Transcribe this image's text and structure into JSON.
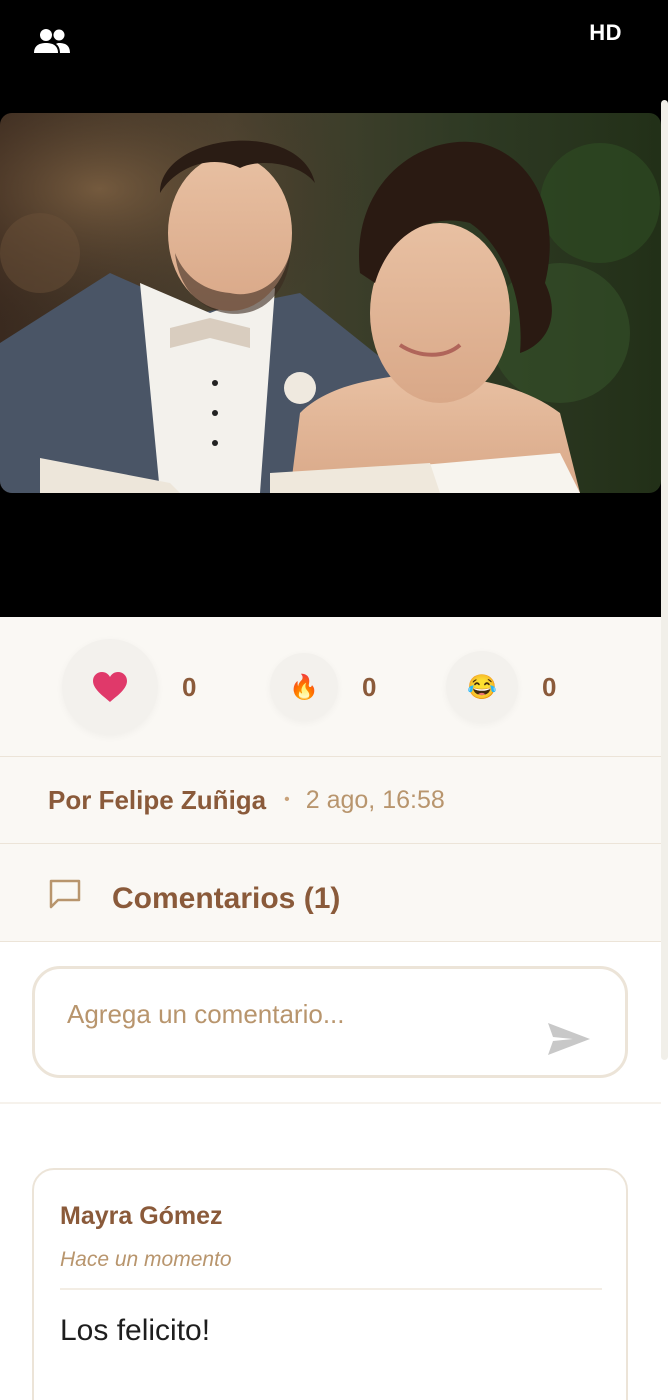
{
  "header": {
    "people_icon": "people-icon",
    "quality_label": "HD"
  },
  "photo": {
    "subject": "wedding-couple-photo"
  },
  "reactions": [
    {
      "icon": "heart-icon",
      "count": "0"
    },
    {
      "icon": "fire-emoji",
      "glyph": "🔥",
      "count": "0"
    },
    {
      "icon": "laughing-emoji",
      "glyph": "😂",
      "count": "0"
    }
  ],
  "post": {
    "author": "Por Felipe Zuñiga",
    "separator": "•",
    "timestamp": "2 ago, 16:58"
  },
  "comments": {
    "header_label": "Comentarios (1)",
    "input_placeholder": "Agrega un comentario...",
    "items": [
      {
        "author": "Mayra Gómez",
        "time": "Hace un momento",
        "text": "Los felicito!"
      }
    ]
  },
  "colors": {
    "accent_brown": "#8a5a3a",
    "muted_tan": "#b8956d",
    "heart_pink": "#e0396a",
    "panel_bg": "#faf8f4"
  }
}
